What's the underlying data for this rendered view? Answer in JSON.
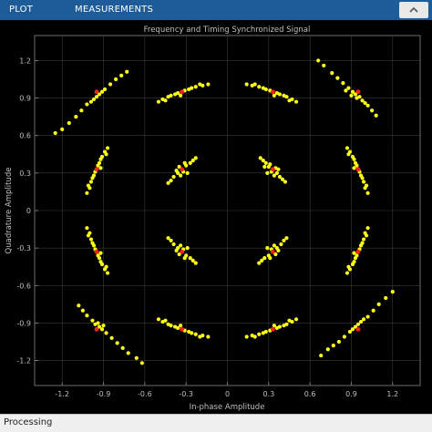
{
  "toolstrip": {
    "tabs": [
      {
        "label": "PLOT"
      },
      {
        "label": "MEASUREMENTS"
      }
    ],
    "collapse_icon": "chevron-up-icon"
  },
  "status": {
    "text": "Processing"
  },
  "colors": {
    "toolstrip": "#1e5c99",
    "plot_bg": "#000000",
    "axes_bg": "#000000",
    "grid": "#3a3a3a",
    "axis_text": "#bfbfbf",
    "points": "#ffff14",
    "reference": "#ff2020"
  },
  "chart_data": {
    "type": "scatter",
    "title": "Frequency and Timing Synchronized Signal",
    "xlabel": "In-phase Amplitude",
    "ylabel": "Quadrature Amplitude",
    "xlim": [
      -1.4,
      1.4
    ],
    "ylim": [
      -1.4,
      1.4
    ],
    "xticks": [
      -1.2,
      -0.9,
      -0.6,
      -0.3,
      0,
      0.3,
      0.6,
      0.9,
      1.2
    ],
    "yticks": [
      -1.2,
      -0.9,
      -0.6,
      -0.3,
      0,
      0.3,
      0.6,
      0.9,
      1.2
    ],
    "xtick_labels": [
      "-1.2",
      "-0.9",
      "-0.6",
      "-0.3",
      "0",
      "0.3",
      "0.6",
      "0.9",
      "1.2"
    ],
    "ytick_labels": [
      "-1.2",
      "-0.9",
      "-0.6",
      "-0.3",
      "0",
      "0.3",
      "0.6",
      "0.9",
      "1.2"
    ],
    "grid": true,
    "legend": "none",
    "series": [
      {
        "values": "received-symbols",
        "points": [
          [
            0.33,
            0.33
          ],
          [
            0.3,
            0.35
          ],
          [
            0.36,
            0.3
          ],
          [
            0.28,
            0.38
          ],
          [
            0.38,
            0.27
          ],
          [
            0.26,
            0.4
          ],
          [
            0.4,
            0.25
          ],
          [
            0.32,
            0.31
          ],
          [
            0.35,
            0.34
          ],
          [
            0.29,
            0.3
          ],
          [
            0.31,
            0.37
          ],
          [
            0.37,
            0.33
          ],
          [
            0.24,
            0.42
          ],
          [
            0.42,
            0.23
          ],
          [
            0.34,
            0.28
          ],
          [
            0.27,
            0.35
          ],
          [
            -0.33,
            0.33
          ],
          [
            -0.3,
            0.36
          ],
          [
            -0.36,
            0.3
          ],
          [
            -0.27,
            0.38
          ],
          [
            -0.39,
            0.27
          ],
          [
            -0.25,
            0.4
          ],
          [
            -0.41,
            0.24
          ],
          [
            -0.32,
            0.31
          ],
          [
            -0.35,
            0.35
          ],
          [
            -0.29,
            0.3
          ],
          [
            -0.31,
            0.38
          ],
          [
            -0.37,
            0.32
          ],
          [
            -0.23,
            0.42
          ],
          [
            -0.43,
            0.22
          ],
          [
            -0.34,
            0.28
          ],
          [
            -0.33,
            -0.33
          ],
          [
            -0.3,
            -0.36
          ],
          [
            -0.36,
            -0.3
          ],
          [
            -0.27,
            -0.38
          ],
          [
            -0.39,
            -0.27
          ],
          [
            -0.25,
            -0.4
          ],
          [
            -0.41,
            -0.24
          ],
          [
            -0.32,
            -0.31
          ],
          [
            -0.35,
            -0.35
          ],
          [
            -0.29,
            -0.3
          ],
          [
            -0.31,
            -0.38
          ],
          [
            -0.37,
            -0.32
          ],
          [
            -0.23,
            -0.42
          ],
          [
            -0.43,
            -0.22
          ],
          [
            -0.34,
            -0.28
          ],
          [
            0.33,
            -0.33
          ],
          [
            0.3,
            -0.36
          ],
          [
            0.36,
            -0.3
          ],
          [
            0.27,
            -0.38
          ],
          [
            0.39,
            -0.27
          ],
          [
            0.25,
            -0.4
          ],
          [
            0.41,
            -0.24
          ],
          [
            0.32,
            -0.31
          ],
          [
            0.35,
            -0.35
          ],
          [
            0.29,
            -0.3
          ],
          [
            0.31,
            -0.38
          ],
          [
            0.37,
            -0.32
          ],
          [
            0.23,
            -0.42
          ],
          [
            0.43,
            -0.22
          ],
          [
            0.34,
            -0.28
          ],
          [
            0.93,
            0.93
          ],
          [
            0.88,
            0.98
          ],
          [
            0.98,
            0.88
          ],
          [
            0.84,
            1.02
          ],
          [
            1.02,
            0.84
          ],
          [
            0.8,
            1.06
          ],
          [
            1.05,
            0.8
          ],
          [
            0.91,
            0.95
          ],
          [
            0.96,
            0.91
          ],
          [
            0.76,
            1.1
          ],
          [
            1.08,
            0.76
          ],
          [
            0.7,
            1.16
          ],
          [
            0.66,
            1.2
          ],
          [
            0.94,
            0.9
          ],
          [
            0.9,
            0.92
          ],
          [
            0.86,
            0.96
          ],
          [
            1.0,
            0.86
          ],
          [
            -0.93,
            0.93
          ],
          [
            -0.97,
            0.89
          ],
          [
            -0.89,
            0.97
          ],
          [
            -1.02,
            0.85
          ],
          [
            -0.85,
            1.01
          ],
          [
            -1.06,
            0.8
          ],
          [
            -0.81,
            1.05
          ],
          [
            -0.95,
            0.91
          ],
          [
            -0.91,
            0.95
          ],
          [
            -1.1,
            0.75
          ],
          [
            -0.77,
            1.08
          ],
          [
            -1.15,
            0.7
          ],
          [
            -1.2,
            0.65
          ],
          [
            -1.25,
            0.62
          ],
          [
            -0.73,
            1.11
          ],
          [
            -0.99,
            0.87
          ],
          [
            -0.93,
            -0.93
          ],
          [
            -0.88,
            -0.98
          ],
          [
            -0.98,
            -0.88
          ],
          [
            -0.84,
            -1.02
          ],
          [
            -1.02,
            -0.84
          ],
          [
            -0.8,
            -1.06
          ],
          [
            -1.05,
            -0.8
          ],
          [
            -0.91,
            -0.95
          ],
          [
            -0.96,
            -0.91
          ],
          [
            -0.76,
            -1.1
          ],
          [
            -1.08,
            -0.76
          ],
          [
            -0.72,
            -1.14
          ],
          [
            -0.66,
            -1.18
          ],
          [
            -0.62,
            -1.22
          ],
          [
            -0.94,
            -0.9
          ],
          [
            -0.9,
            -0.92
          ],
          [
            0.93,
            -0.93
          ],
          [
            0.97,
            -0.89
          ],
          [
            0.89,
            -0.97
          ],
          [
            1.02,
            -0.85
          ],
          [
            0.85,
            -1.01
          ],
          [
            1.06,
            -0.8
          ],
          [
            0.81,
            -1.05
          ],
          [
            0.95,
            -0.91
          ],
          [
            0.91,
            -0.95
          ],
          [
            1.1,
            -0.75
          ],
          [
            0.77,
            -1.08
          ],
          [
            1.15,
            -0.7
          ],
          [
            1.2,
            -0.65
          ],
          [
            0.73,
            -1.11
          ],
          [
            0.68,
            -1.16
          ],
          [
            0.99,
            -0.87
          ],
          [
            0.33,
            0.95
          ],
          [
            0.28,
            0.97
          ],
          [
            0.38,
            0.93
          ],
          [
            0.23,
            0.99
          ],
          [
            0.43,
            0.91
          ],
          [
            0.18,
            1.0
          ],
          [
            0.47,
            0.89
          ],
          [
            0.31,
            0.96
          ],
          [
            0.36,
            0.94
          ],
          [
            0.26,
            0.98
          ],
          [
            0.41,
            0.92
          ],
          [
            0.2,
            1.01
          ],
          [
            0.45,
            0.88
          ],
          [
            0.14,
            1.01
          ],
          [
            0.5,
            0.87
          ],
          [
            0.34,
            0.92
          ],
          [
            -0.33,
            0.95
          ],
          [
            -0.28,
            0.97
          ],
          [
            -0.38,
            0.93
          ],
          [
            -0.23,
            0.99
          ],
          [
            -0.43,
            0.91
          ],
          [
            -0.18,
            1.0
          ],
          [
            -0.47,
            0.89
          ],
          [
            -0.31,
            0.96
          ],
          [
            -0.36,
            0.94
          ],
          [
            -0.26,
            0.98
          ],
          [
            -0.41,
            0.92
          ],
          [
            -0.2,
            1.01
          ],
          [
            -0.45,
            0.88
          ],
          [
            -0.14,
            1.01
          ],
          [
            -0.5,
            0.87
          ],
          [
            -0.34,
            0.92
          ],
          [
            -0.33,
            -0.95
          ],
          [
            -0.28,
            -0.97
          ],
          [
            -0.38,
            -0.93
          ],
          [
            -0.23,
            -0.99
          ],
          [
            -0.43,
            -0.91
          ],
          [
            -0.18,
            -1.0
          ],
          [
            -0.47,
            -0.89
          ],
          [
            -0.31,
            -0.96
          ],
          [
            -0.36,
            -0.94
          ],
          [
            -0.26,
            -0.98
          ],
          [
            -0.41,
            -0.92
          ],
          [
            -0.2,
            -1.01
          ],
          [
            -0.45,
            -0.88
          ],
          [
            -0.14,
            -1.01
          ],
          [
            -0.5,
            -0.87
          ],
          [
            -0.34,
            -0.92
          ],
          [
            0.33,
            -0.95
          ],
          [
            0.28,
            -0.97
          ],
          [
            0.38,
            -0.93
          ],
          [
            0.23,
            -0.99
          ],
          [
            0.43,
            -0.91
          ],
          [
            0.18,
            -1.0
          ],
          [
            0.47,
            -0.89
          ],
          [
            0.31,
            -0.96
          ],
          [
            0.36,
            -0.94
          ],
          [
            0.26,
            -0.98
          ],
          [
            0.41,
            -0.92
          ],
          [
            0.2,
            -1.01
          ],
          [
            0.45,
            -0.88
          ],
          [
            0.14,
            -1.01
          ],
          [
            0.5,
            -0.87
          ],
          [
            0.34,
            -0.92
          ],
          [
            0.95,
            0.33
          ],
          [
            0.97,
            0.28
          ],
          [
            0.93,
            0.38
          ],
          [
            0.99,
            0.23
          ],
          [
            0.91,
            0.43
          ],
          [
            1.0,
            0.18
          ],
          [
            0.89,
            0.47
          ],
          [
            0.96,
            0.31
          ],
          [
            0.94,
            0.36
          ],
          [
            0.98,
            0.26
          ],
          [
            0.92,
            0.41
          ],
          [
            1.01,
            0.2
          ],
          [
            0.88,
            0.45
          ],
          [
            1.02,
            0.14
          ],
          [
            0.87,
            0.5
          ],
          [
            0.92,
            0.34
          ],
          [
            -0.95,
            0.33
          ],
          [
            -0.97,
            0.28
          ],
          [
            -0.93,
            0.38
          ],
          [
            -0.99,
            0.23
          ],
          [
            -0.91,
            0.43
          ],
          [
            -1.0,
            0.18
          ],
          [
            -0.89,
            0.47
          ],
          [
            -0.96,
            0.31
          ],
          [
            -0.94,
            0.36
          ],
          [
            -0.98,
            0.26
          ],
          [
            -0.92,
            0.41
          ],
          [
            -1.01,
            0.2
          ],
          [
            -0.88,
            0.45
          ],
          [
            -1.02,
            0.14
          ],
          [
            -0.87,
            0.5
          ],
          [
            -0.92,
            0.34
          ],
          [
            -0.95,
            -0.33
          ],
          [
            -0.97,
            -0.28
          ],
          [
            -0.93,
            -0.38
          ],
          [
            -0.99,
            -0.23
          ],
          [
            -0.91,
            -0.43
          ],
          [
            -1.0,
            -0.18
          ],
          [
            -0.89,
            -0.47
          ],
          [
            -0.96,
            -0.31
          ],
          [
            -0.94,
            -0.36
          ],
          [
            -0.98,
            -0.26
          ],
          [
            -0.92,
            -0.41
          ],
          [
            -1.01,
            -0.2
          ],
          [
            -0.88,
            -0.45
          ],
          [
            -1.02,
            -0.14
          ],
          [
            -0.87,
            -0.5
          ],
          [
            -0.92,
            -0.34
          ],
          [
            0.95,
            -0.33
          ],
          [
            0.97,
            -0.28
          ],
          [
            0.93,
            -0.38
          ],
          [
            0.99,
            -0.23
          ],
          [
            0.91,
            -0.43
          ],
          [
            1.0,
            -0.18
          ],
          [
            0.89,
            -0.47
          ],
          [
            0.96,
            -0.31
          ],
          [
            0.94,
            -0.36
          ],
          [
            0.98,
            -0.26
          ],
          [
            0.92,
            -0.41
          ],
          [
            1.01,
            -0.2
          ],
          [
            0.88,
            -0.45
          ],
          [
            1.02,
            -0.14
          ],
          [
            0.87,
            -0.5
          ],
          [
            0.92,
            -0.34
          ]
        ]
      },
      {
        "values": "reference-constellation",
        "points": [
          [
            0.33,
            0.33
          ],
          [
            -0.33,
            0.33
          ],
          [
            -0.33,
            -0.33
          ],
          [
            0.33,
            -0.33
          ],
          [
            0.95,
            0.95
          ],
          [
            -0.95,
            0.95
          ],
          [
            -0.95,
            -0.95
          ],
          [
            0.95,
            -0.95
          ],
          [
            0.33,
            0.95
          ],
          [
            -0.33,
            0.95
          ],
          [
            -0.33,
            -0.95
          ],
          [
            0.33,
            -0.95
          ],
          [
            0.95,
            0.33
          ],
          [
            -0.95,
            0.33
          ],
          [
            -0.95,
            -0.33
          ],
          [
            0.95,
            -0.33
          ]
        ]
      }
    ]
  }
}
